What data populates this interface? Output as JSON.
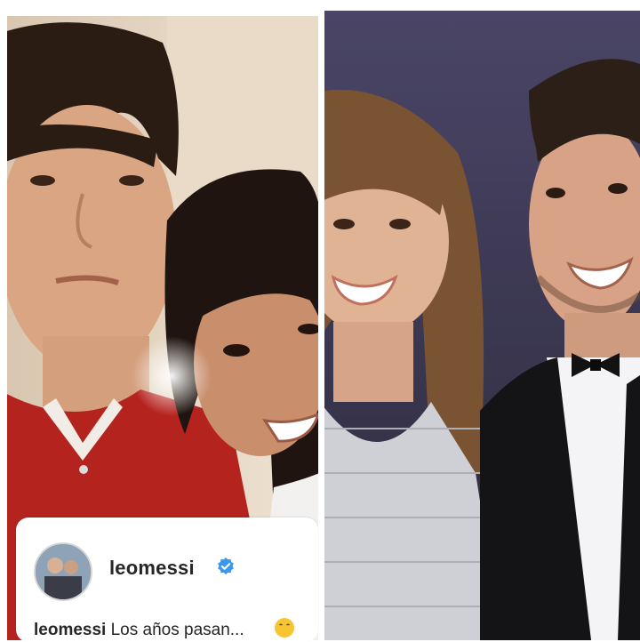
{
  "post": {
    "username": "leomessi",
    "caption_user": "leomessi",
    "caption_text": "Los años pasan..."
  },
  "icons": {
    "verified": "verified-badge-icon",
    "emoji": "smiling-face-emoji-icon"
  },
  "colors": {
    "verified_blue": "#3897f0",
    "left_photo_red_shirt": "#b5231f",
    "right_photo_backdrop": "#3a3650"
  }
}
